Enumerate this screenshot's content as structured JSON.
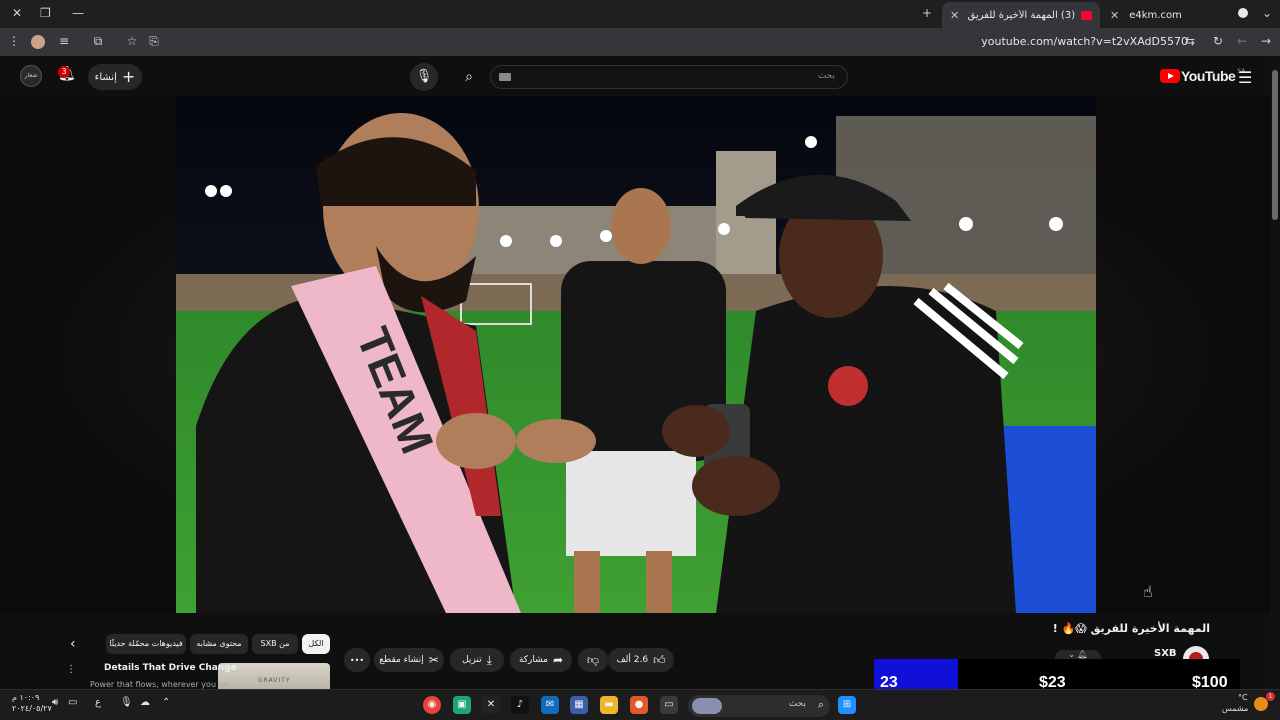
{
  "browser": {
    "tabs": [
      {
        "title": "e4km.com",
        "active": false
      },
      {
        "title": "(3) المهمة الأخيرة للفريق 😱",
        "active": true
      }
    ],
    "url": "youtube.com/watch?v=t2vXAdD5570",
    "new_tab_symbol": "+",
    "window_controls": [
      "—",
      "❐",
      "✕"
    ]
  },
  "youtube": {
    "logo_text": "YouTube",
    "country_code": "SA",
    "search_placeholder": "بحث",
    "create_label": "إنشاء",
    "notification_count": "3",
    "avatar_label": "شعار"
  },
  "video": {
    "title": "المهمة الأخيرة للفريق 😱🔥 !",
    "channel_name": "SXB",
    "actions": {
      "like_count": "2.6 ألف",
      "share": "مشاركة",
      "download": "تنزيل",
      "clip": "إنشاء مقطع",
      "more": "•••"
    }
  },
  "chips": [
    {
      "label": "الكل",
      "selected": true
    },
    {
      "label": "من SXB",
      "selected": false
    },
    {
      "label": "محتوى مشابه",
      "selected": false
    },
    {
      "label": "فيديوهات محمّلة حديثًا",
      "selected": false
    }
  ],
  "recommendation": {
    "title": "Details That Drive Change",
    "subtitle": "Power that flows, wherever you go",
    "thumb_text": "GRAVITY"
  },
  "overlay": {
    "count": "23",
    "middle_amount": "$23",
    "right_amount": "$100"
  },
  "taskbar": {
    "search_label": "بحث",
    "clock_time": "١٠:٠٩ م",
    "clock_date": "٢٠٢٤/٠٥/٢٧",
    "weather_label": "مشمس",
    "weather_temp": "°C",
    "lang": "ع"
  },
  "colors": {
    "youtube_red": "#ff0000",
    "overlay_blue": "#1010d8",
    "background": "#0f0f0f"
  }
}
